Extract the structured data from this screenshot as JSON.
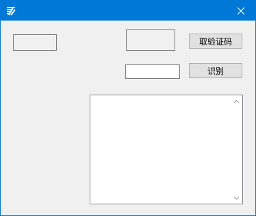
{
  "window": {
    "title": "",
    "icon": "app-logo-icon",
    "close_icon": "close-icon"
  },
  "buttons": {
    "get_captcha": "取验证码",
    "recognize": "识别"
  },
  "captcha_input": {
    "value": "",
    "placeholder": ""
  },
  "output_text": {
    "value": ""
  },
  "colors": {
    "titlebar": "#0078d7",
    "client": "#f0f0f0"
  }
}
